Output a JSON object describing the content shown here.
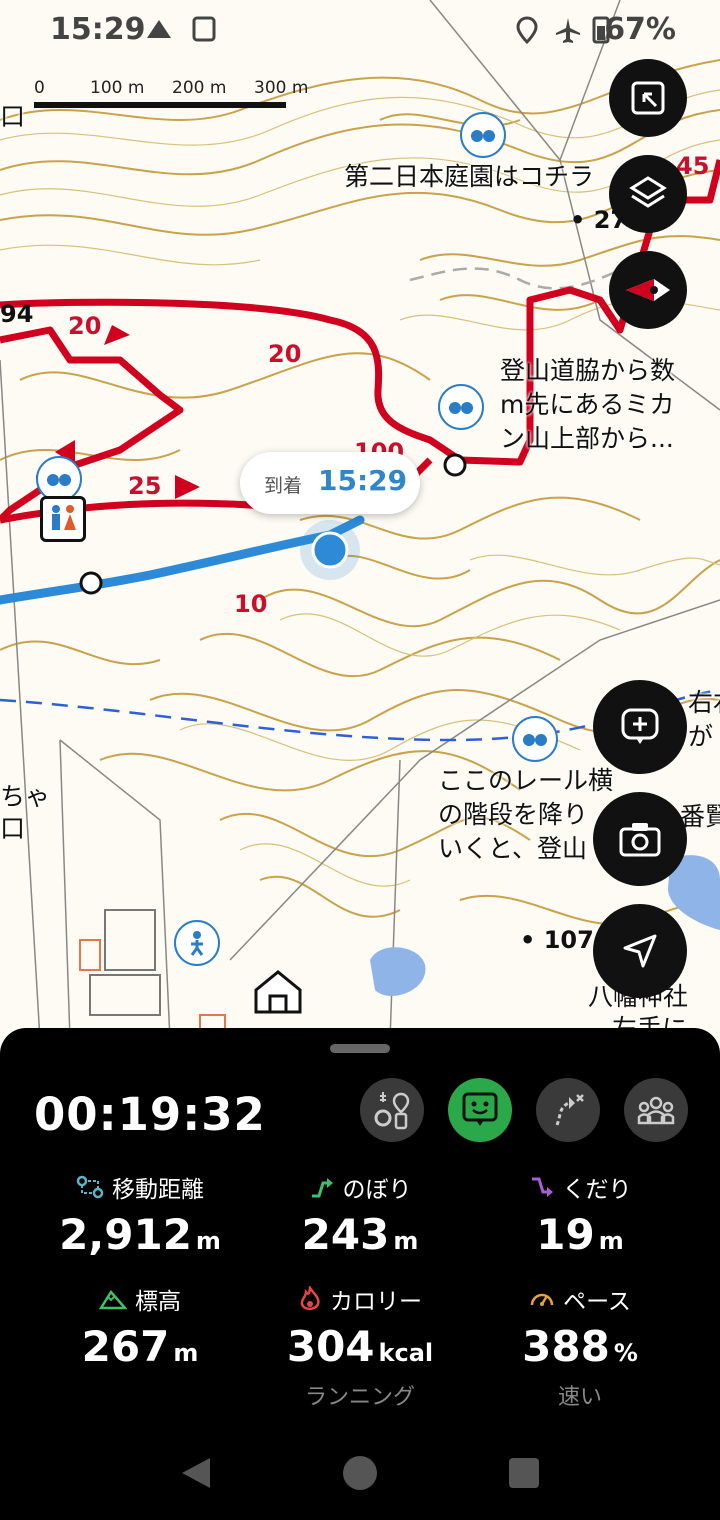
{
  "status_bar": {
    "time": "15:29",
    "battery": "67%"
  },
  "scale_bar": {
    "labels": [
      "0",
      "100 m",
      "200 m",
      "300 m"
    ]
  },
  "map": {
    "labels": [
      "第二日本庭園はコチラ",
      "登山道脇から数",
      "m先にあるミカ",
      "ン山上部から...",
      "ここのレール横",
      "の階段を降り",
      "いくと、登山",
      "右右",
      "が",
      "番賢",
      "八幡神社",
      "左手に",
      "ちゃ",
      "口",
      "口"
    ],
    "route_numbers": [
      "20",
      "20",
      "25",
      "25",
      "10",
      "100",
      "45"
    ],
    "elevations": [
      "• 27",
      "• 107",
      "94"
    ]
  },
  "arrival_bubble": {
    "label": "到着",
    "time": "15:29"
  },
  "bottom_sheet": {
    "timer": "00:19:32",
    "stats": [
      {
        "label": "移動距離",
        "value": "2,912",
        "unit": "m",
        "sub": ""
      },
      {
        "label": "のぼり",
        "value": "243",
        "unit": "m",
        "sub": ""
      },
      {
        "label": "くだり",
        "value": "19",
        "unit": "m",
        "sub": ""
      },
      {
        "label": "標高",
        "value": "267",
        "unit": "m",
        "sub": ""
      },
      {
        "label": "カロリー",
        "value": "304",
        "unit": "kcal",
        "sub": "ランニング"
      },
      {
        "label": "ペース",
        "value": "388",
        "unit": "%",
        "sub": "速い"
      }
    ]
  },
  "colors": {
    "route_red": "#d1001f",
    "track_blue": "#2d8ad6",
    "contour": "#c9a24a",
    "accent_green": "#2aa84a"
  }
}
